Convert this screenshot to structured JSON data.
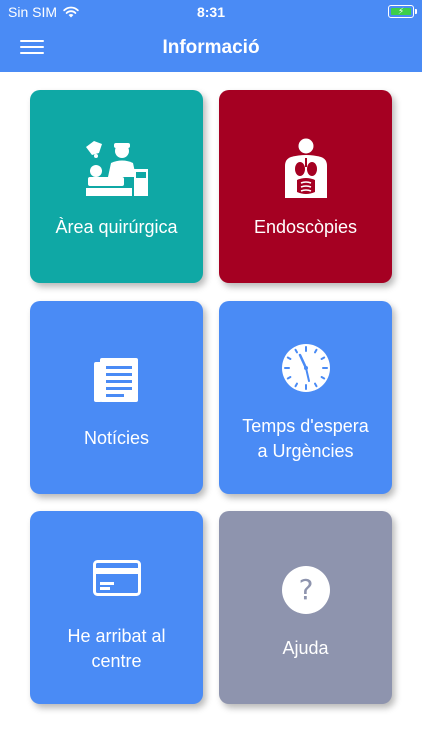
{
  "status": {
    "carrier": "Sin SIM",
    "time": "8:31",
    "battery_charging": true
  },
  "nav": {
    "title": "Informació",
    "menu_icon": "hamburger-menu-icon"
  },
  "colors": {
    "header": "#4A8BF5",
    "teal": "#0FA8A5",
    "crimson": "#A50022",
    "blue": "#4A8BF5",
    "gray": "#8E94AE"
  },
  "tiles": [
    {
      "label": "Àrea quirúrgica",
      "icon": "surgery-icon"
    },
    {
      "label": "Endoscòpies",
      "icon": "body-organs-icon"
    },
    {
      "label": "Notícies",
      "icon": "newspaper-icon"
    },
    {
      "label": "Temps d'espera\na Urgències",
      "icon": "clock-icon"
    },
    {
      "label": "He arribat al\ncentre",
      "icon": "card-icon"
    },
    {
      "label": "Ajuda",
      "icon": "help-icon"
    }
  ]
}
